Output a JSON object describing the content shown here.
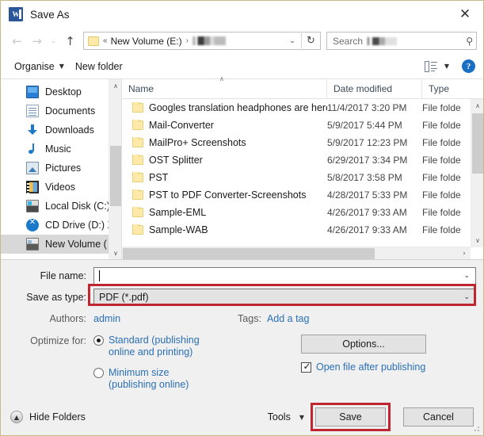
{
  "window": {
    "title": "Save As",
    "app_icon": "word-icon",
    "close_label": "✕"
  },
  "nav": {
    "back_label": "←",
    "forward_label": "→",
    "recent_label": "⌄",
    "up_label": "↑",
    "address": {
      "folder_icon": "folder-icon",
      "overflow_chevrons": "«",
      "segments": [
        "New Volume (E:)"
      ],
      "separator": "›",
      "redacted_segment": true,
      "dropdown_caret": "⌄"
    },
    "refresh_label": "↻",
    "search": {
      "placeholder": "Search",
      "redacted_suffix": true,
      "icon": "search-icon",
      "icon_glyph": "⚲"
    }
  },
  "commandbar": {
    "organise_label": "Organise",
    "organise_caret": "▼",
    "new_folder_label": "New folder",
    "view_icon": "view-layout-icon",
    "view_caret": "▼",
    "help_label": "?"
  },
  "sidebar": {
    "scroll_up": "∧",
    "scroll_down": "∨",
    "items": [
      {
        "label": "Desktop",
        "icon": "desktop-icon",
        "icon_class": "ico-desktop",
        "selected": false
      },
      {
        "label": "Documents",
        "icon": "documents-icon",
        "icon_class": "ico-docs",
        "selected": false
      },
      {
        "label": "Downloads",
        "icon": "downloads-icon",
        "icon_class": "ico-dl",
        "selected": false
      },
      {
        "label": "Music",
        "icon": "music-icon",
        "icon_class": "ico-music",
        "selected": false
      },
      {
        "label": "Pictures",
        "icon": "pictures-icon",
        "icon_class": "ico-pic",
        "selected": false
      },
      {
        "label": "Videos",
        "icon": "videos-icon",
        "icon_class": "ico-vid",
        "selected": false
      },
      {
        "label": "Local Disk (C:)",
        "icon": "local-disk-icon",
        "icon_class": "ico-disk",
        "selected": false
      },
      {
        "label": "CD Drive (D:) X",
        "icon": "cd-drive-icon",
        "icon_class": "ico-cd",
        "selected": false
      },
      {
        "label": "New Volume (",
        "icon": "volume-icon",
        "icon_class": "ico-vol",
        "selected": true
      }
    ]
  },
  "filelist": {
    "columns": [
      "Name",
      "Date modified",
      "Type"
    ],
    "sort_caret": "∧",
    "rows": [
      {
        "name": "Googles translation headphones are here...",
        "date": "11/4/2017 3:20 PM",
        "type": "File folde"
      },
      {
        "name": "Mail-Converter",
        "date": "5/9/2017 5:44 PM",
        "type": "File folde"
      },
      {
        "name": "MailPro+ Screenshots",
        "date": "5/9/2017 12:23 PM",
        "type": "File folde"
      },
      {
        "name": "OST Splitter",
        "date": "6/29/2017 3:34 PM",
        "type": "File folde"
      },
      {
        "name": "PST",
        "date": "5/8/2017 3:58 PM",
        "type": "File folde"
      },
      {
        "name": "PST to PDF Converter-Screenshots",
        "date": "4/28/2017 5:33 PM",
        "type": "File folde"
      },
      {
        "name": "Sample-EML",
        "date": "4/26/2017 9:33 AM",
        "type": "File folde"
      },
      {
        "name": "Sample-WAB",
        "date": "4/26/2017 9:33 AM",
        "type": "File folde"
      }
    ],
    "vscroll_up": "∧",
    "vscroll_down": "∨",
    "hscroll_right": "›"
  },
  "form": {
    "filename_label": "File name:",
    "filename_value": "",
    "filename_caret": "⌄",
    "savetype_label": "Save as type:",
    "savetype_value": "PDF (*.pdf)",
    "savetype_caret": "⌄",
    "authors_label": "Authors:",
    "authors_value": "admin",
    "tags_label": "Tags:",
    "tags_value": "Add a tag",
    "optimize_label": "Optimize for:",
    "radio_standard_line1": "Standard (publishing",
    "radio_standard_line2": "online and printing)",
    "radio_standard_selected": true,
    "radio_minimum_line1": "Minimum size",
    "radio_minimum_line2": "(publishing online)",
    "radio_minimum_selected": false,
    "options_label": "Options...",
    "openfile_label": "Open file after publishing",
    "openfile_checked": true
  },
  "footer": {
    "hide_folders_label": "Hide Folders",
    "hide_folders_icon": "▲",
    "tools_label": "Tools",
    "tools_caret": "▼",
    "save_label": "Save",
    "cancel_label": "Cancel"
  },
  "highlights": {
    "accent_red": "#c0262f",
    "link_blue": "#2a6fb5",
    "word_blue": "#2b579a",
    "selection_gray": "#d8d8d8"
  }
}
